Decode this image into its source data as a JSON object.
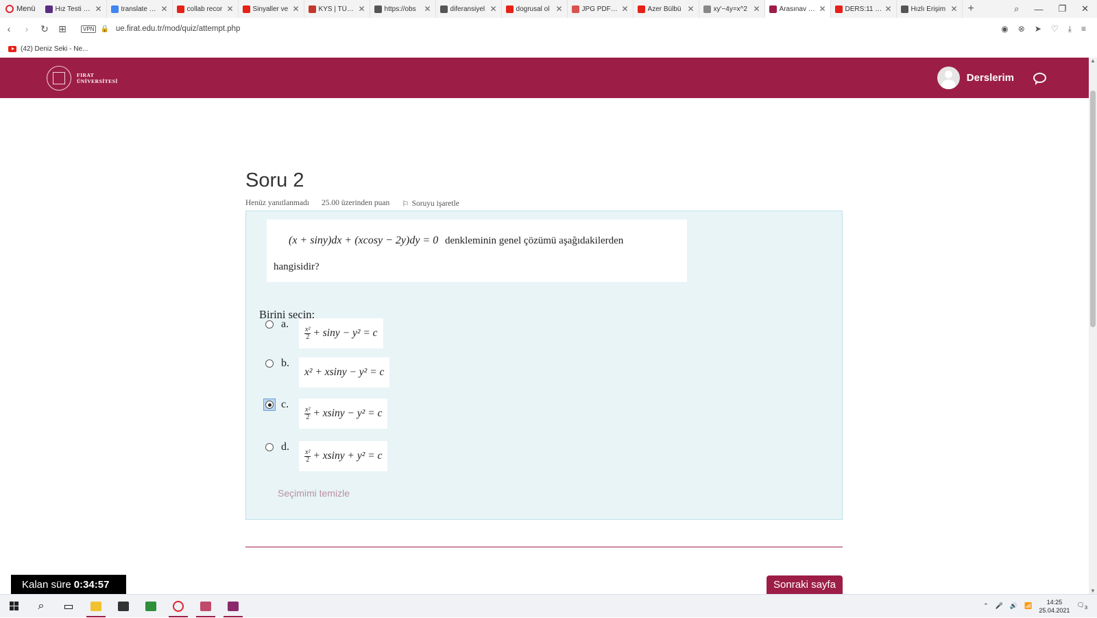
{
  "browser": {
    "menu_label": "Menü",
    "tabs": [
      {
        "title": "Hız Testi - Sp",
        "color": "#5a2d82"
      },
      {
        "title": "translate - G",
        "color": "#4285f4"
      },
      {
        "title": "collab recor",
        "color": "#e62117"
      },
      {
        "title": "Sinyaller ve",
        "color": "#e62117"
      },
      {
        "title": "KYS | TÜRK",
        "color": "#c0392b"
      },
      {
        "title": "https://obs",
        "color": "#555555"
      },
      {
        "title": "diferansiyel",
        "color": "#555555"
      },
      {
        "title": "dogrusal ol",
        "color": "#e62117"
      },
      {
        "title": "JPG PDF Çe",
        "color": "#d9534f"
      },
      {
        "title": "Azer Bülbü",
        "color": "#e62117"
      },
      {
        "title": "xy'−4y=x^2",
        "color": "#888888"
      },
      {
        "title": "Arasınav (sa",
        "color": "#9c1e47",
        "active": true
      },
      {
        "title": "DERS:11 KA",
        "color": "#e62117"
      },
      {
        "title": "Hızlı Erişim",
        "color": "#555555"
      }
    ],
    "url": "ue.firat.edu.tr/mod/quiz/attempt.php",
    "vpn_label": "VPN",
    "bookmark": "(42) Deniz Seki - Ne..."
  },
  "site": {
    "logo_line1": "FIRAT",
    "logo_line2": "ÜNİVERSİTESİ",
    "courses_label": "Derslerim",
    "brand_color": "#9c1e47"
  },
  "question": {
    "title": "Soru 2",
    "status": "Henüz yanıtlanmadı",
    "points": "25.00 üzerinden puan",
    "flag_label": "Soruyu işaretle",
    "equation": "(x + siny)dx + (xcosy − 2y)dy = 0",
    "text_after": "denkleminin genel çözümü aşağıdakilerden",
    "text_line2": "hangisidir?",
    "prompt": "Birini seçin:",
    "options": [
      {
        "letter": "a.",
        "frac_num": "x²",
        "frac_den": "2",
        "expr": "+ siny − y² = c",
        "checked": false
      },
      {
        "letter": "b.",
        "frac_num": "",
        "frac_den": "",
        "expr": "x² + xsiny − y² = c",
        "checked": false
      },
      {
        "letter": "c.",
        "frac_num": "x²",
        "frac_den": "2",
        "expr": "+ xsiny − y² = c",
        "checked": true
      },
      {
        "letter": "d.",
        "frac_num": "x²",
        "frac_den": "2",
        "expr": "+ xsiny + y² = c",
        "checked": false
      }
    ],
    "clear_label": "Seçimimi temizle"
  },
  "timer": {
    "label": "Kalan süre",
    "value": "0:34:57"
  },
  "next_button": "Sonraki sayfa",
  "taskbar": {
    "time": "14:25",
    "date": "25.04.2021",
    "notif_count": "3"
  }
}
